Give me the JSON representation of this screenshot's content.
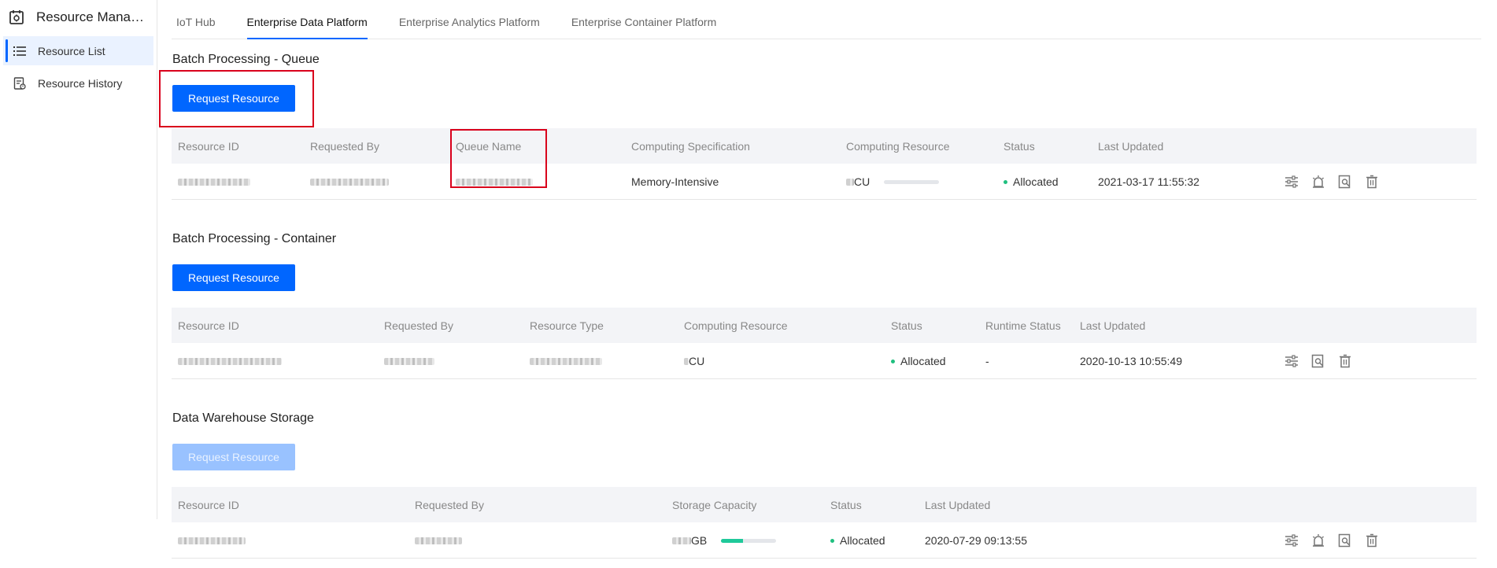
{
  "app": {
    "title": "Resource Manag...",
    "icon": "resource-app-icon"
  },
  "sidebar": {
    "items": [
      {
        "label": "Resource List",
        "icon": "list-icon",
        "active": true
      },
      {
        "label": "Resource History",
        "icon": "history-icon",
        "active": false
      }
    ]
  },
  "tabs": [
    {
      "label": "IoT Hub",
      "active": false
    },
    {
      "label": "Enterprise Data Platform",
      "active": true
    },
    {
      "label": "Enterprise Analytics Platform",
      "active": false
    },
    {
      "label": "Enterprise Container Platform",
      "active": false
    }
  ],
  "request_label": "Request Resource",
  "queue": {
    "title": "Batch Processing - Queue",
    "columns": [
      "Resource ID",
      "Requested By",
      "Queue Name",
      "Computing Specification",
      "Computing Resource",
      "Status",
      "Last Updated"
    ],
    "row": {
      "spec": "Memory-Intensive",
      "compute_unit": "CU",
      "status": "Allocated",
      "updated": "2021-03-17 11:55:32",
      "usage_fraction": 0.0
    }
  },
  "container": {
    "title": "Batch Processing - Container",
    "columns": [
      "Resource ID",
      "Requested By",
      "Resource Type",
      "Computing Resource",
      "Status",
      "Runtime Status",
      "Last Updated"
    ],
    "row": {
      "compute_unit": "CU",
      "status": "Allocated",
      "runtime_status": "-",
      "updated": "2020-10-13 10:55:49"
    }
  },
  "warehouse": {
    "title": "Data Warehouse Storage",
    "columns": [
      "Resource ID",
      "Requested By",
      "Storage Capacity",
      "Status",
      "Last Updated"
    ],
    "row": {
      "storage_unit": "GB",
      "status": "Allocated",
      "updated": "2020-07-29 09:13:55",
      "usage_fraction": 0.4
    }
  },
  "colors": {
    "primary": "#0066ff",
    "success": "#1fbf7f",
    "highlight": "#d9001b"
  }
}
